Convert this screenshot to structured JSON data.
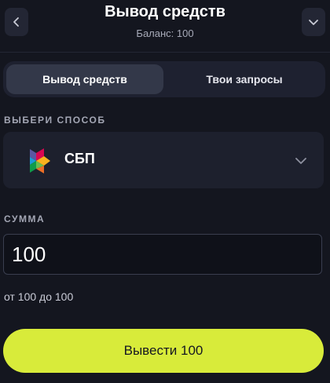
{
  "header": {
    "title": "Вывод средств",
    "balance": "Баланс: 100",
    "back_icon": "chevron-left-icon",
    "menu_icon": "chevron-down-icon"
  },
  "tabs": [
    {
      "label": "Вывод средств",
      "active": true
    },
    {
      "label": "Твои запросы",
      "active": false
    }
  ],
  "method": {
    "label": "ВЫБЕРИ СПОСОБ",
    "selected": "СБП",
    "logo_icon": "sbp-logo-icon",
    "chevron_icon": "chevron-down-icon"
  },
  "amount": {
    "label": "СУММА",
    "value": "100",
    "hint": "от 100 до 100"
  },
  "submit": {
    "label": "Вывести 100"
  },
  "colors": {
    "background": "#14161f",
    "accent": "#d8eb3a",
    "panel": "#1d202d",
    "active_tab": "#333849"
  }
}
